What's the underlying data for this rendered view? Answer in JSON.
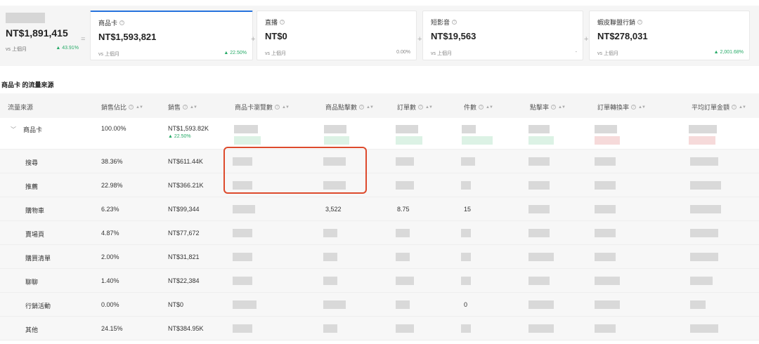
{
  "summary": {
    "total": {
      "value": "NT$1,891,415",
      "compare": "vs 上個月",
      "change": "43.91%"
    },
    "equals": "=",
    "plus": "+",
    "cards": [
      {
        "name": "商品卡",
        "value": "NT$1,593,821",
        "compare": "vs 上個月",
        "change": "22.50%",
        "trend": "up"
      },
      {
        "name": "直播",
        "value": "NT$0",
        "compare": "vs 上個月",
        "change": "0.00%",
        "trend": "none"
      },
      {
        "name": "短影音",
        "value": "NT$19,563",
        "compare": "vs 上個月",
        "change": "-",
        "trend": "none"
      },
      {
        "name": "蝦皮聯盟行銷",
        "value": "NT$278,031",
        "compare": "vs 上個月",
        "change": "2,001.68%",
        "trend": "up"
      }
    ]
  },
  "section_title": "商品卡 的流量來源",
  "table": {
    "headers": [
      "流量來源",
      "銷售佔比",
      "銷售",
      "商品卡瀏覽數",
      "商品點擊數",
      "訂單數",
      "件數",
      "點擊率",
      "訂單轉換率",
      "平均訂單金額"
    ],
    "main_row": {
      "source": "商品卡",
      "share": "100.00%",
      "sales": "NT$1,593.82K",
      "sales_change": "22.50%"
    },
    "rows": [
      {
        "source": "搜尋",
        "share": "38.36%",
        "sales": "NT$611.44K",
        "clicks": "",
        "orders": "",
        "units": ""
      },
      {
        "source": "推薦",
        "share": "22.98%",
        "sales": "NT$366.21K",
        "clicks": "",
        "orders": "",
        "units": ""
      },
      {
        "source": "購物車",
        "share": "6.23%",
        "sales": "NT$99,344",
        "clicks": "3,522",
        "orders": "8.75",
        "units": "15"
      },
      {
        "source": "賣場頁",
        "share": "4.87%",
        "sales": "NT$77,672",
        "clicks": "",
        "orders": "",
        "units": ""
      },
      {
        "source": "購買清單",
        "share": "2.00%",
        "sales": "NT$31,821",
        "clicks": "",
        "orders": "",
        "units": ""
      },
      {
        "source": "聊聊",
        "share": "1.40%",
        "sales": "NT$22,384",
        "clicks": "",
        "orders": "",
        "units": ""
      },
      {
        "source": "行銷活動",
        "share": "0.00%",
        "sales": "NT$0",
        "clicks": "",
        "orders": "",
        "units": "0"
      },
      {
        "source": "其他",
        "share": "24.15%",
        "sales": "NT$384.95K",
        "clicks": "",
        "orders": "",
        "units": ""
      }
    ]
  },
  "icons": {
    "help": "question-circle-icon",
    "sort": "sort-arrows-icon",
    "expand": "chevron-down-icon",
    "trend": "triangle-up-icon"
  },
  "colors": {
    "accent": "#2673dd",
    "positive": "#26aa67",
    "highlight": "#dd4a2c"
  }
}
